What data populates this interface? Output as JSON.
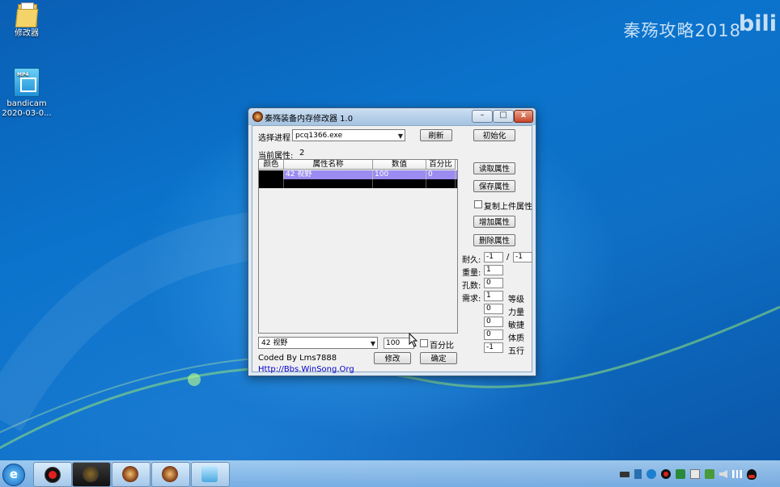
{
  "desktop": {
    "icons": [
      {
        "label": "修改器",
        "icon": "folder-icon"
      },
      {
        "label": "bandicam",
        "label2": "2020-03-0...",
        "icon": "video-file-icon",
        "tag": "MP4"
      }
    ],
    "watermark": "秦殇攻略2018",
    "watermark_logo": "bili"
  },
  "window": {
    "title": "秦殇装备内存修改器 1.0",
    "controls": {
      "minimize": "–",
      "maximize": "□",
      "close": "x"
    },
    "process_label": "选择进程",
    "process_value": "pcq1366.exe",
    "refresh_button": "刷新",
    "init_button": "初始化",
    "current_attr_label": "当前属性:",
    "current_attr_count": "2",
    "table": {
      "headers": [
        "颜色",
        "属性名称",
        "数值",
        "百分比"
      ],
      "rows": [
        {
          "color": "",
          "name": "42 视野",
          "value": "100",
          "percent": "0"
        },
        {
          "color": "",
          "name": "",
          "value": "",
          "percent": ""
        }
      ]
    },
    "side_buttons": {
      "read": "读取属性",
      "save": "保存属性",
      "copy_label": "复制上件属性",
      "add": "增加属性",
      "delete": "删除属性"
    },
    "stats": {
      "durability_label": "耐久:",
      "durability_cur": "-1",
      "slash": "/",
      "durability_max": "-1",
      "weight_label": "重量:",
      "weight": "1",
      "holes_label": "孔数:",
      "holes": "0",
      "req_label": "需求:",
      "req_level": "1",
      "level_label": "等级",
      "req_str": "0",
      "str_label": "力量",
      "req_agi": "0",
      "agi_label": "敏捷",
      "req_con": "0",
      "con_label": "体质",
      "req_element": "-1",
      "element_label": "五行"
    },
    "bottom": {
      "attr_select": "42 视野",
      "value": "100",
      "percent_label": "百分比",
      "credit": "Coded By Lms7888",
      "link": "Http://Bbs.WinSong.Org",
      "modify_button": "modify",
      "modify_label": "修改",
      "confirm_button": "确定"
    }
  },
  "taskbar": {
    "start_icon": "ie-icon",
    "items": [
      "record-icon",
      "game-icon",
      "game-icon",
      "game-icon",
      "game-icon"
    ],
    "tray": [
      "keyboard-icon",
      "network-icon",
      "record-icon",
      "globe-icon",
      "folder-icon",
      "shield-icon",
      "monitor-icon",
      "volume-icon",
      "signal-icon",
      "qq-icon"
    ]
  },
  "colors": {
    "desktop": "#0b6fc6",
    "selected_row": "#9a8cf0",
    "link": "#0000cc"
  }
}
